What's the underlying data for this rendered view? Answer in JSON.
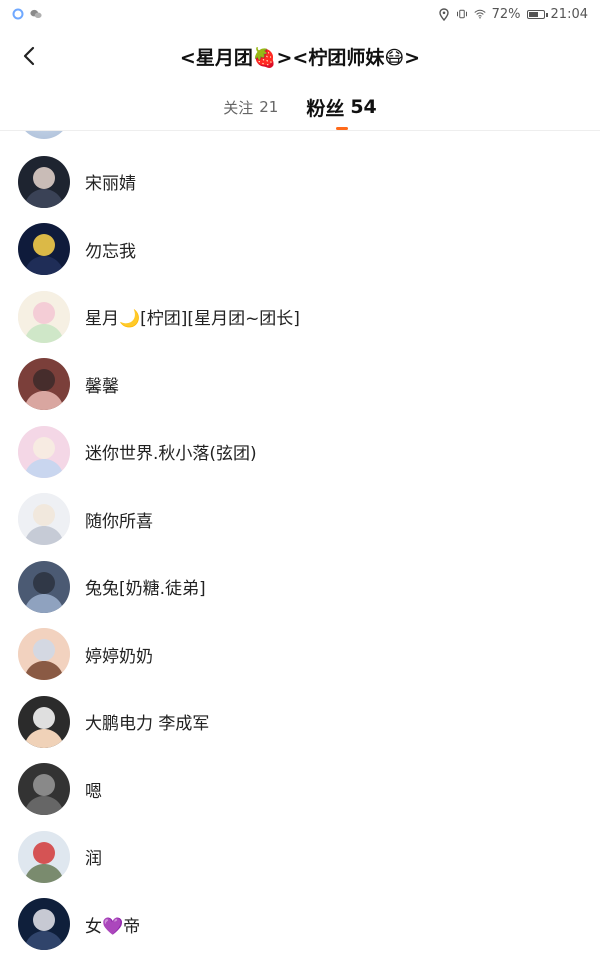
{
  "status_bar": {
    "battery": "72%",
    "battery_level": 0.72,
    "time": "21:04"
  },
  "header": {
    "title": "<星月团🍓><柠团师妹😷>"
  },
  "tabs": {
    "following_label": "关注",
    "following_count": "21",
    "fans_label": "粉丝",
    "fans_count": "54"
  },
  "fans": [
    {
      "name": "宋丽婧",
      "avatar_colors": [
        "#1e2430",
        "#3a4256",
        "#e8d7cf"
      ]
    },
    {
      "name": "勿忘我",
      "avatar_colors": [
        "#0f1b3b",
        "#1f2d57",
        "#ffd54a"
      ]
    },
    {
      "name": "星月🌙[柠团][星月团~团长]",
      "avatar_colors": [
        "#f6f0e3",
        "#cfe7c8",
        "#f3c7d4"
      ]
    },
    {
      "name": "馨馨",
      "avatar_colors": [
        "#7b3f3a",
        "#d9a6a0",
        "#3d2a2a"
      ]
    },
    {
      "name": "迷你世界.秋小落(弦团)",
      "avatar_colors": [
        "#f4d7e6",
        "#c9d6ef",
        "#f7efe1"
      ]
    },
    {
      "name": "随你所喜",
      "avatar_colors": [
        "#eef0f4",
        "#c6cbd6",
        "#f1e6d8"
      ]
    },
    {
      "name": "兔兔[奶糖.徒弟]",
      "avatar_colors": [
        "#4b5a73",
        "#8fa2bf",
        "#2c3240"
      ]
    },
    {
      "name": "婷婷奶奶",
      "avatar_colors": [
        "#f2d2bf",
        "#8a5a44",
        "#cfd9e8"
      ]
    },
    {
      "name": "大鹏电力 李成军",
      "avatar_colors": [
        "#2b2b2b",
        "#f0d2b8",
        "#ffffff"
      ]
    },
    {
      "name": "嗯",
      "avatar_colors": [
        "#333333",
        "#666666",
        "#999999"
      ]
    },
    {
      "name": "润",
      "avatar_colors": [
        "#dfe7ef",
        "#7a8b6e",
        "#d43838"
      ]
    },
    {
      "name": "女💜帝",
      "avatar_colors": [
        "#0f1f3b",
        "#30446b",
        "#e7e7ee"
      ]
    }
  ],
  "icons": {
    "back": "chevron-left-icon",
    "location": "location-icon",
    "vibrate": "vibrate-icon",
    "wifi": "wifi-icon",
    "battery": "battery-icon"
  },
  "colors": {
    "accent": "#ff6a1a",
    "text_primary": "#222222",
    "text_secondary": "#666666"
  }
}
